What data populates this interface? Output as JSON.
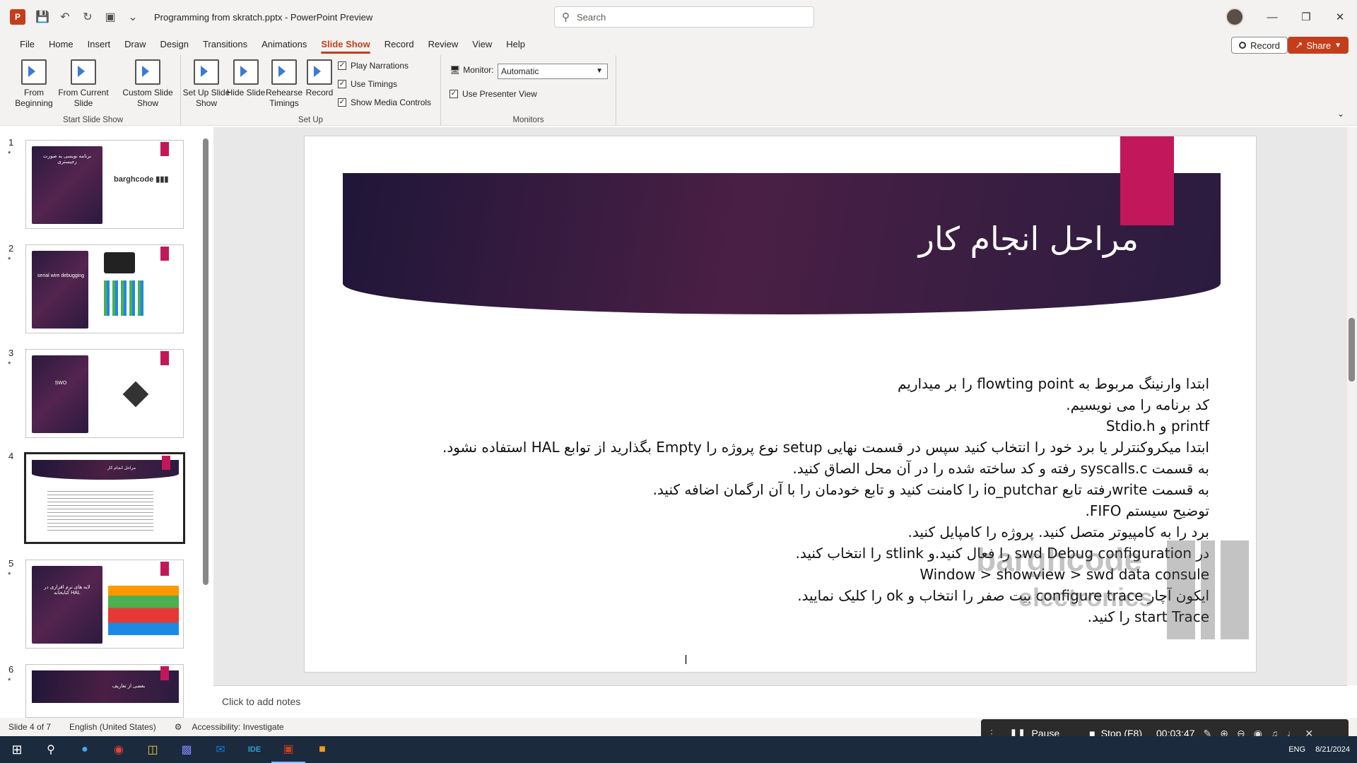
{
  "app": {
    "doc_title": "Programming from skratch.pptx",
    "app_name": "PowerPoint Preview",
    "search_placeholder": "Search"
  },
  "menu": {
    "tabs": [
      "File",
      "Home",
      "Insert",
      "Draw",
      "Design",
      "Transitions",
      "Animations",
      "Slide Show",
      "Record",
      "Review",
      "View",
      "Help"
    ],
    "active_tab": "Slide Show",
    "record_label": "Record",
    "share_label": "Share"
  },
  "ribbon": {
    "start": {
      "label": "Start Slide Show",
      "from_beginning": "From Beginning",
      "from_current": "From Current Slide",
      "custom": "Custom Slide Show"
    },
    "setup": {
      "label": "Set Up",
      "setup_show": "Set Up Slide Show",
      "hide_slide": "Hide Slide",
      "rehearse": "Rehearse Timings",
      "record": "Record",
      "play_narrations": "Play Narrations",
      "use_timings": "Use Timings",
      "show_media": "Show Media Controls"
    },
    "monitors": {
      "label": "Monitors",
      "monitor_label": "Monitor:",
      "monitor_value": "Automatic",
      "presenter_view": "Use Presenter View"
    }
  },
  "thumbnails": [
    {
      "num": "1",
      "text": "برنامه نویسی به صورت رجیستری"
    },
    {
      "num": "2",
      "text": "serial wire debugging"
    },
    {
      "num": "3",
      "text": "SWO"
    },
    {
      "num": "4",
      "text": "مراحل انجام کار"
    },
    {
      "num": "5",
      "text": "لایه های نرم افزاری در کتابخانه HAL"
    },
    {
      "num": "6",
      "text": "بعضی از تعاریف"
    }
  ],
  "slide": {
    "title": "مراحل انجام کار",
    "lines": [
      "ابتدا وارنینگ مربوط به flowting point را بر میداریم",
      "کد برنامه را می نویسیم.",
      "printf و Stdio.h",
      "ابتدا میکروکنترلر یا برد خود را انتخاب کنید سپس در قسمت نهایی setup نوع پروژه را Empty بگذارید از توابع HAL استفاده نشود.",
      "به قسمت syscalls.c رفته و کد ساخته شده را در آن محل الصاق کنید.",
      "به قسمت writeرفته تابع io_putchar را کامنت کنید و تابع خودمان را با آن ارگمان اضافه کنید.",
      "توضیح سیستم FIFO.",
      "برد را به کامپیوتر متصل کنید. پروژه را کامپایل کنید.",
      "در swd Debug configuration را فعال کنید.و stlink را انتخاب کنید.",
      "Window > showview > swd data consule",
      "ایکون آچار configure trace بیت صفر را انتخاب و ok را کلیک نمایید.",
      "start Trace را کنید."
    ],
    "watermark_top": "barghcode",
    "watermark_bottom": "electronics"
  },
  "notes_placeholder": "Click to add notes",
  "status": {
    "slide_info": "Slide 4 of 7",
    "language": "English (United States)",
    "accessibility": "Accessibility: Investigate"
  },
  "recorder": {
    "pause": "Pause",
    "stop": "Stop (F8)",
    "time": "00:03:47"
  },
  "tray": {
    "lang": "ENG",
    "date": "8/21/2024"
  }
}
